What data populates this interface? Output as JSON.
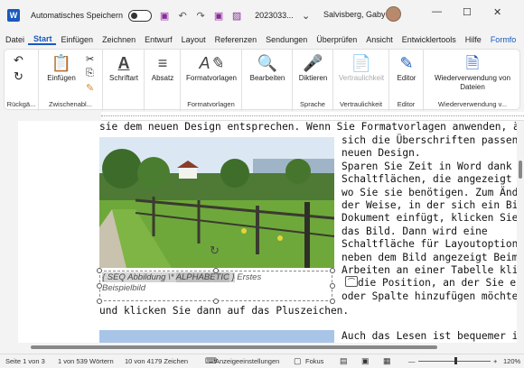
{
  "titlebar": {
    "app_icon": "W",
    "autosave_label": "Automatisches Speichern",
    "doc_title": "2023033...",
    "user_name": "Salvisberg, Gaby",
    "minimize": "—",
    "maximize": "☐",
    "close": "✕"
  },
  "tabs": [
    "Datei",
    "Start",
    "Einfügen",
    "Zeichnen",
    "Entwurf",
    "Layout",
    "Referenzen",
    "Sendungen",
    "Überprüfen",
    "Ansicht",
    "Entwicklertools",
    "Hilfe",
    "Formfo"
  ],
  "ribbon": {
    "groups": [
      {
        "label": "Rückgä...",
        "buttons": []
      },
      {
        "label": "Zwischenabl...",
        "buttons": [
          "Einfügen"
        ]
      },
      {
        "label": "",
        "buttons": [
          "Schriftart"
        ]
      },
      {
        "label": "",
        "buttons": [
          "Absatz"
        ]
      },
      {
        "label": "Formatvorlagen",
        "buttons": [
          "Formatvorlagen"
        ]
      },
      {
        "label": "",
        "buttons": [
          "Bearbeiten"
        ]
      },
      {
        "label": "Sprache",
        "buttons": [
          "Diktieren"
        ]
      },
      {
        "label": "Vertraulichkeit",
        "buttons": [
          "Vertraulichkeit"
        ]
      },
      {
        "label": "Editor",
        "buttons": [
          "Editor"
        ]
      },
      {
        "label": "Wiederverwendung v...",
        "buttons": [
          "Wiederverwendung von Dateien"
        ]
      }
    ]
  },
  "document": {
    "line_top": "sie dem neuen Design entsprechen. Wenn Sie Formatvorlagen anwenden, än",
    "right_lines": [
      "sich die Überschriften passend",
      "neuen Design.",
      "Sparen Sie Zeit in Word dank n",
      "Schaltflächen, die angezeigt we",
      "wo Sie sie benötigen. Zum Änd",
      "der Weise, in der sich ein Bild i",
      "Dokument einfügt, klicken Sie a",
      "das Bild. Dann wird eine",
      "Schaltfläche für Layoutoptionen",
      "neben dem Bild angezeigt Beim",
      "Arbeiten an einer Tabelle klicke",
      "die Position, an der Sie eine",
      "oder Spalte hinzufügen möchte"
    ],
    "line_after": "und klicken Sie dann auf das Pluszeichen.",
    "line_last": "Auch das Lesen ist bequemer in",
    "caption": {
      "field_open": "{ SEQ Abbildung \\* ",
      "field_switch": "ALPHABETIC",
      "field_close": " }",
      "caption_text": " Erstes",
      "caption_line2": "Beispielbild"
    }
  },
  "statusbar": {
    "page": "Seite 1 von 3",
    "words": "1 von 539 Wörtern",
    "chars": "10 von 4179 Zeichen",
    "display_settings": "Anzeigeeinstellungen",
    "focus": "Fokus",
    "zoom_minus": "—",
    "zoom_plus": "+",
    "zoom": "120%"
  },
  "colors": {
    "accent": "#185abd",
    "quick_access": "#8a2b9a"
  }
}
